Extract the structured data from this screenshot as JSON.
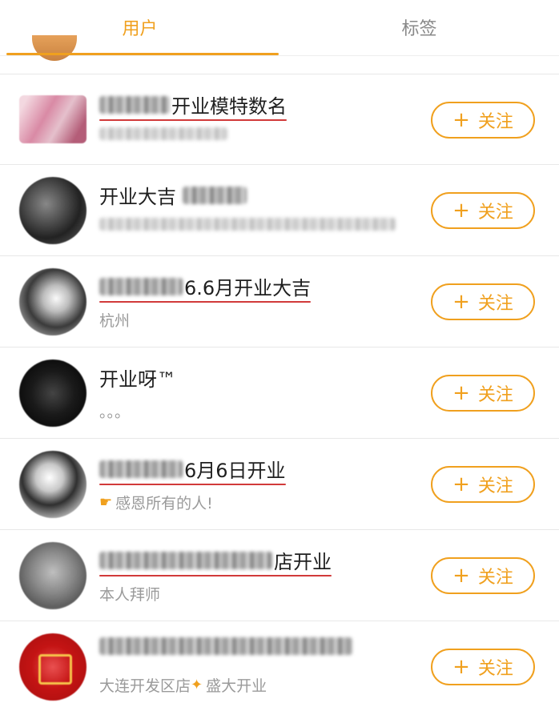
{
  "tabs": [
    {
      "label": "用户",
      "active": true
    },
    {
      "label": "标签",
      "active": false
    }
  ],
  "accent_color": "#f0a01e",
  "users": [
    {
      "name_visible": "开业模特数名",
      "name_obscured": true,
      "underlined": true,
      "subtitle": "",
      "subtitle_obscured": true,
      "follow_label": "关注"
    },
    {
      "name_visible": "开业大吉",
      "name_obscured_suffix": true,
      "underlined": false,
      "subtitle": "",
      "subtitle_obscured": true,
      "follow_label": "关注"
    },
    {
      "name_visible": "6.6月开业大吉",
      "name_obscured": true,
      "underlined": true,
      "subtitle": "杭州",
      "follow_label": "关注"
    },
    {
      "name_visible": "开业呀™",
      "underlined": false,
      "subtitle": "。。。",
      "follow_label": "关注"
    },
    {
      "name_visible": "6月6日开业",
      "name_obscured": true,
      "underlined": true,
      "subtitle": "感恩所有的人!",
      "subtitle_icon": "pointing-hand-icon",
      "follow_label": "关注"
    },
    {
      "name_visible": "店开业",
      "name_obscured": true,
      "underlined": true,
      "subtitle": "本人拜师",
      "follow_label": "关注"
    },
    {
      "name_visible": "",
      "name_obscured": true,
      "underlined": false,
      "subtitle": "大连开发区店",
      "subtitle_icon": "party-popper-icon",
      "subtitle_tail": "盛大开业",
      "follow_label": "关注"
    }
  ]
}
